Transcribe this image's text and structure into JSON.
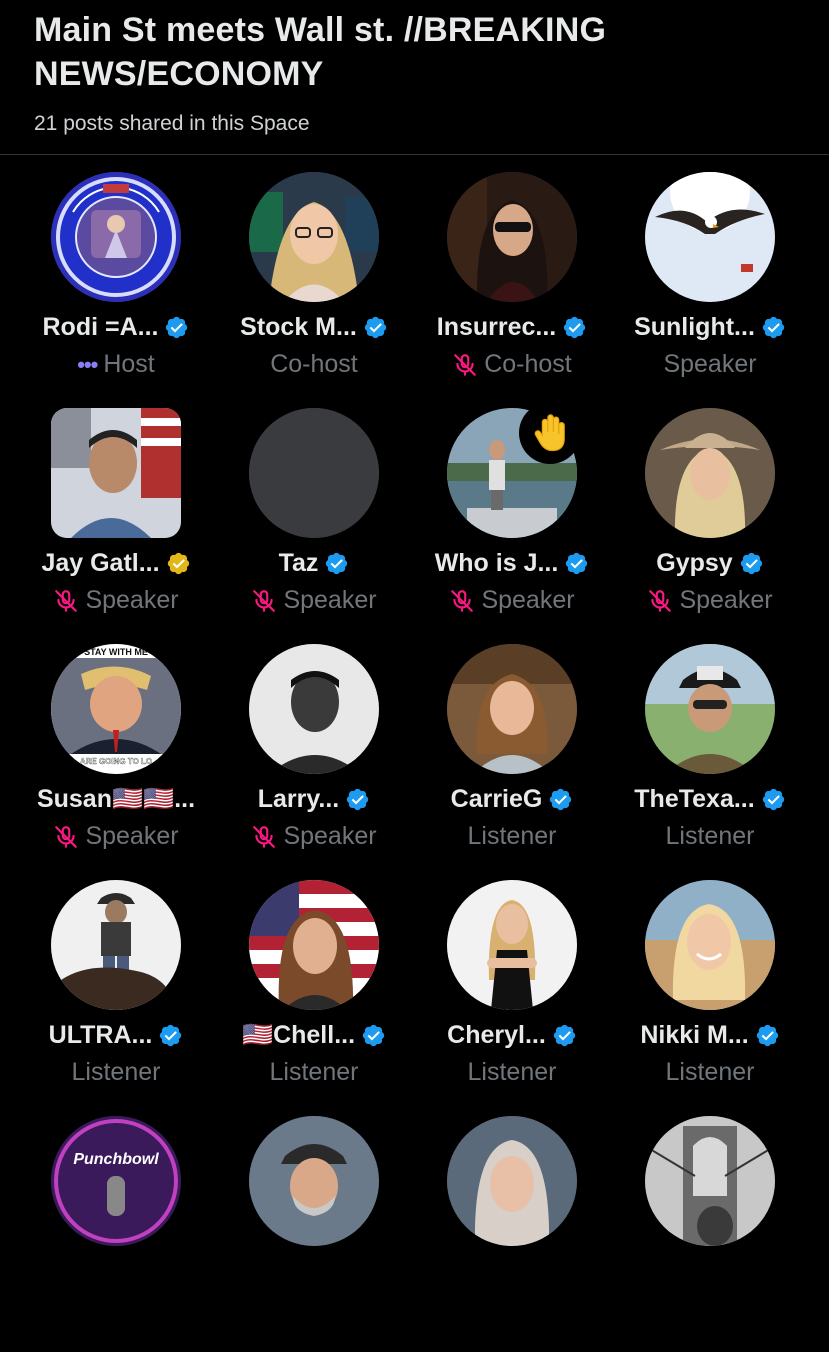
{
  "header": {
    "title": "Main St meets Wall st. //BREAKING NEWS/ECONOMY",
    "subtitle": "21 posts shared in this Space"
  },
  "colors": {
    "verified_blue": "#1d9bf0",
    "verified_gold": "#e2b719",
    "muted_mic": "#f91880",
    "host_dots": "#8b7cf6",
    "role_text": "#71767b"
  },
  "participants": [
    {
      "name": "Rodi =A...",
      "role": "Host",
      "verified": "blue",
      "muted": false,
      "host_indicator": true,
      "avatar": "bluehand-seal-logo"
    },
    {
      "name": "Stock M...",
      "role": "Co-host",
      "verified": "blue",
      "muted": false,
      "avatar": "woman-blonde-glasses"
    },
    {
      "name": "Insurrec...",
      "role": "Co-host",
      "verified": "blue",
      "muted": true,
      "avatar": "woman-dark-hair-sunglasses"
    },
    {
      "name": "Sunlight...",
      "role": "Speaker",
      "verified": "blue",
      "muted": false,
      "avatar": "eagle-sky"
    },
    {
      "name": "Jay Gatl...",
      "role": "Speaker",
      "verified": "gold",
      "muted": true,
      "avatar": "man-flag-square"
    },
    {
      "name": "Taz",
      "role": "Speaker",
      "verified": "blue",
      "muted": true,
      "avatar": "blank-gray"
    },
    {
      "name": "Who is J...",
      "role": "Speaker",
      "verified": "blue",
      "muted": true,
      "hand_raised": true,
      "avatar": "man-on-boat"
    },
    {
      "name": "Gypsy",
      "role": "Speaker",
      "verified": "blue",
      "muted": true,
      "avatar": "woman-cowboy-hat"
    },
    {
      "name": "Susan🇺🇸🇺🇸...",
      "role": "Speaker",
      "verified": "none",
      "muted": true,
      "avatar": "trump-poster"
    },
    {
      "name": "Larry...",
      "role": "Speaker",
      "verified": "blue",
      "muted": true,
      "avatar": "man-gray-photo"
    },
    {
      "name": "CarrieG",
      "role": "Listener",
      "verified": "blue",
      "muted": false,
      "avatar": "woman-brown-hair"
    },
    {
      "name": "TheTexa...",
      "role": "Listener",
      "verified": "blue",
      "muted": false,
      "avatar": "man-black-cap"
    },
    {
      "name": "ULTRA...",
      "role": "Listener",
      "verified": "blue",
      "muted": false,
      "avatar": "cowboy-horse"
    },
    {
      "name": "🇺🇸Chell...",
      "role": "Listener",
      "verified": "blue",
      "muted": false,
      "avatar": "woman-flag-background"
    },
    {
      "name": "Cheryl...",
      "role": "Listener",
      "verified": "blue",
      "muted": false,
      "avatar": "woman-black-dress"
    },
    {
      "name": "Nikki M...",
      "role": "Listener",
      "verified": "blue",
      "muted": false,
      "avatar": "woman-blonde-smiling"
    },
    {
      "avatar": "punchbowl-logo"
    },
    {
      "avatar": "man-with-cap"
    },
    {
      "avatar": "woman-gray-hair"
    },
    {
      "avatar": "brooklyn-bridge"
    }
  ]
}
